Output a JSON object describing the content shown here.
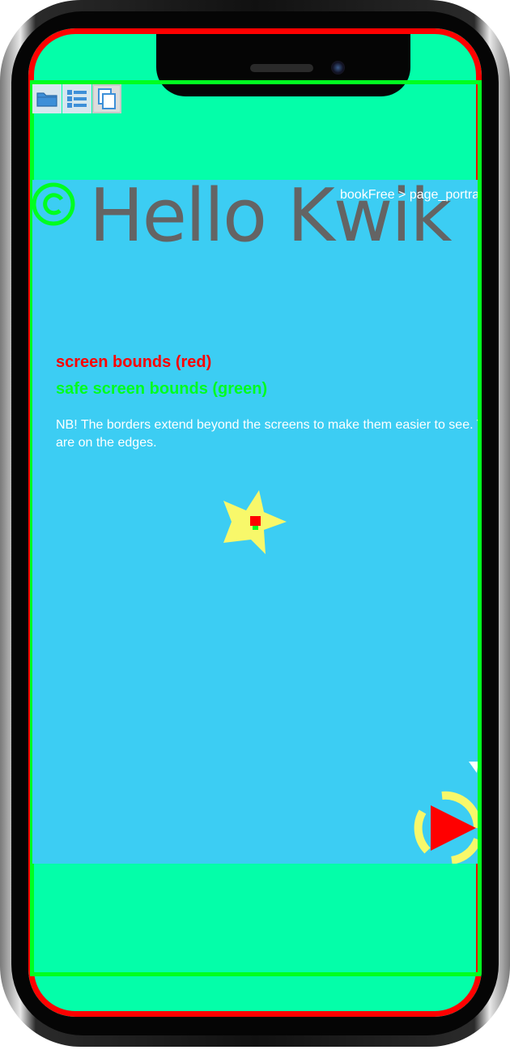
{
  "toolbar": {
    "items": [
      {
        "name": "folder-icon"
      },
      {
        "name": "list-icon"
      },
      {
        "name": "copy-pages-icon"
      }
    ]
  },
  "page": {
    "title": "Hello Kwik",
    "breadcrumb": "bookFree > page_portrait",
    "screen_bounds_label": "screen bounds (red)",
    "safe_bounds_label": "safe screen bounds (green)",
    "note": "NB! The borders extend beyond the screens to make them easier to see. They are on the edges."
  },
  "colors": {
    "screen_bg": "#04fea9",
    "content_bg": "#3ccdf3",
    "screen_bounds": "#ff0000",
    "safe_bounds": "#00ff20",
    "title": "#646464",
    "star": "#f8f86a"
  },
  "icons": {
    "reload": "refresh-ring-icon",
    "star": "star-icon",
    "next": "play-next-icon"
  }
}
